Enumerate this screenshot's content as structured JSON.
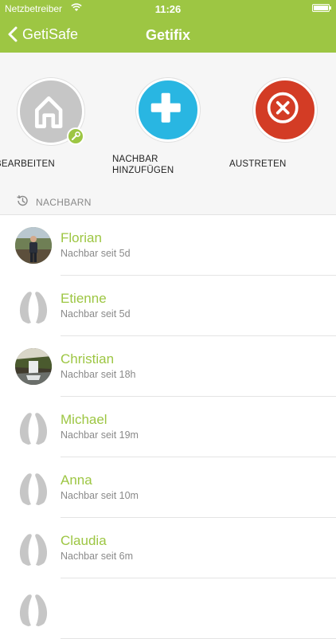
{
  "status": {
    "carrier": "Netzbetreiber",
    "time": "11:26"
  },
  "nav": {
    "back_label": "GetiSafe",
    "title": "Getifix"
  },
  "actions": {
    "edit_label": "BEARBEITEN",
    "add_label_1": "NACHBAR",
    "add_label_2": "HINZUFÜGEN",
    "leave_label": "AUSTRETEN"
  },
  "colors": {
    "accent": "#9dc643",
    "add": "#29b6e2",
    "leave": "#d33c25",
    "placeholder": "#c6c6c6"
  },
  "section": {
    "label": "NACHBARN",
    "icon": "history-icon"
  },
  "neighbors": [
    {
      "name": "Florian",
      "since": "Nachbar seit 5d",
      "avatar": "photo-person"
    },
    {
      "name": "Etienne",
      "since": "Nachbar seit 5d",
      "avatar": "placeholder"
    },
    {
      "name": "Christian",
      "since": "Nachbar seit 18h",
      "avatar": "photo-waterfall"
    },
    {
      "name": "Michael",
      "since": "Nachbar seit 19m",
      "avatar": "placeholder"
    },
    {
      "name": "Anna",
      "since": "Nachbar seit 10m",
      "avatar": "placeholder"
    },
    {
      "name": "Claudia",
      "since": "Nachbar seit 6m",
      "avatar": "placeholder"
    }
  ]
}
